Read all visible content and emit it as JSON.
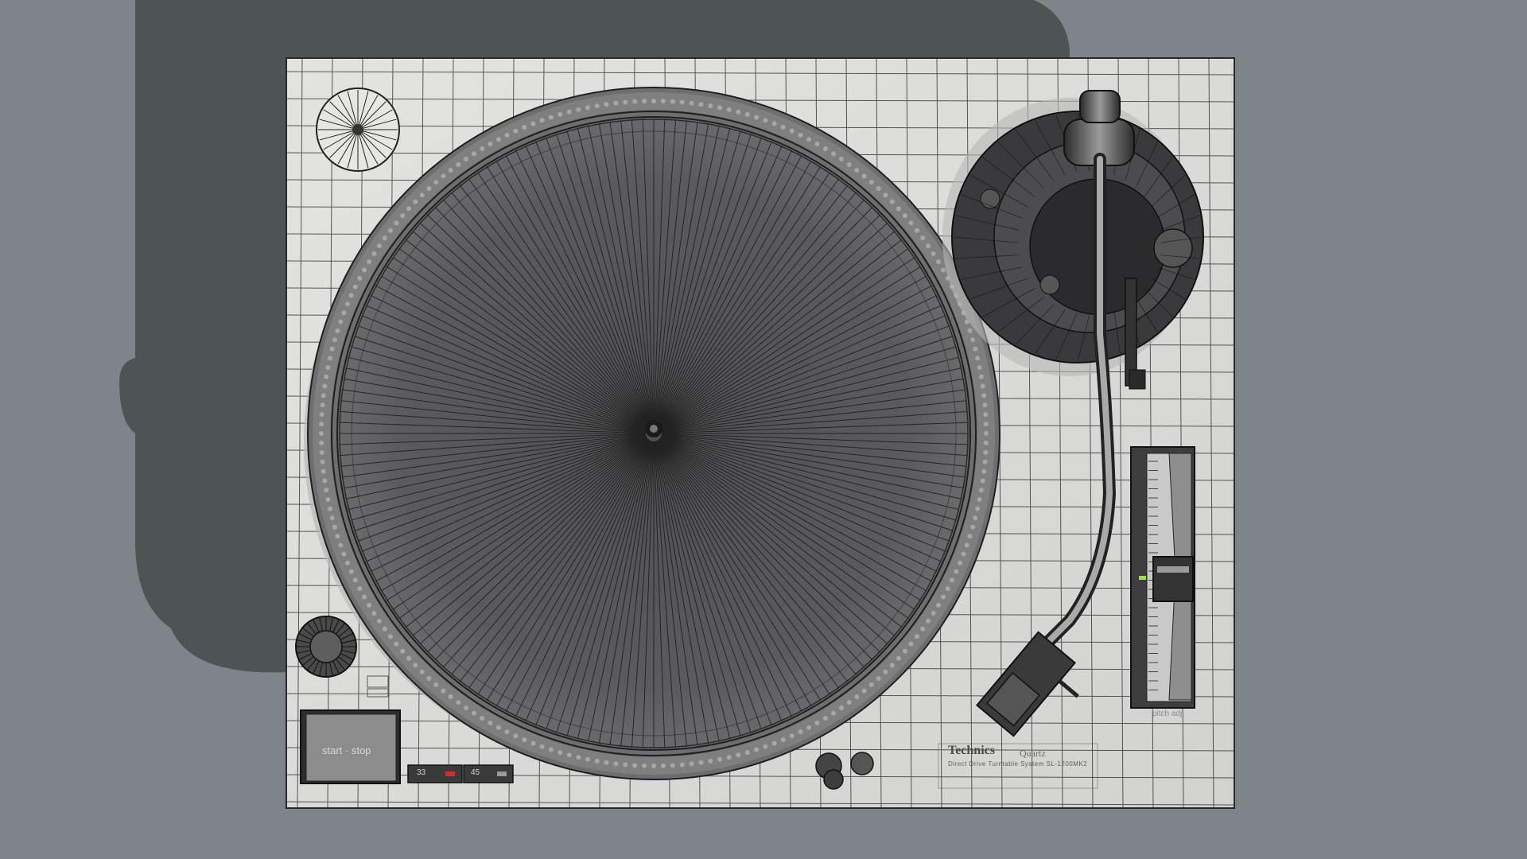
{
  "product": {
    "brand": "Technics",
    "subbrand": "Quartz",
    "model_line": "Direct Drive Turntable System SL-1200MK2"
  },
  "controls": {
    "start_stop_label": "start · stop",
    "speed_33_label": "33",
    "speed_45_label": "45",
    "pitch_label": "pitch adj"
  },
  "colors": {
    "background": "#7d858b",
    "shadow": "#4c5053",
    "deck_plate": "#dcdcda",
    "platter": "#5b5b5d",
    "wire": "#1e1e1e",
    "speed_led": "#d42b2b",
    "pitch_led": "#9be24a"
  },
  "icons": {
    "power_knob": "power-knob-icon",
    "strobe_light": "strobe-light-icon",
    "spindle": "spindle-icon"
  }
}
